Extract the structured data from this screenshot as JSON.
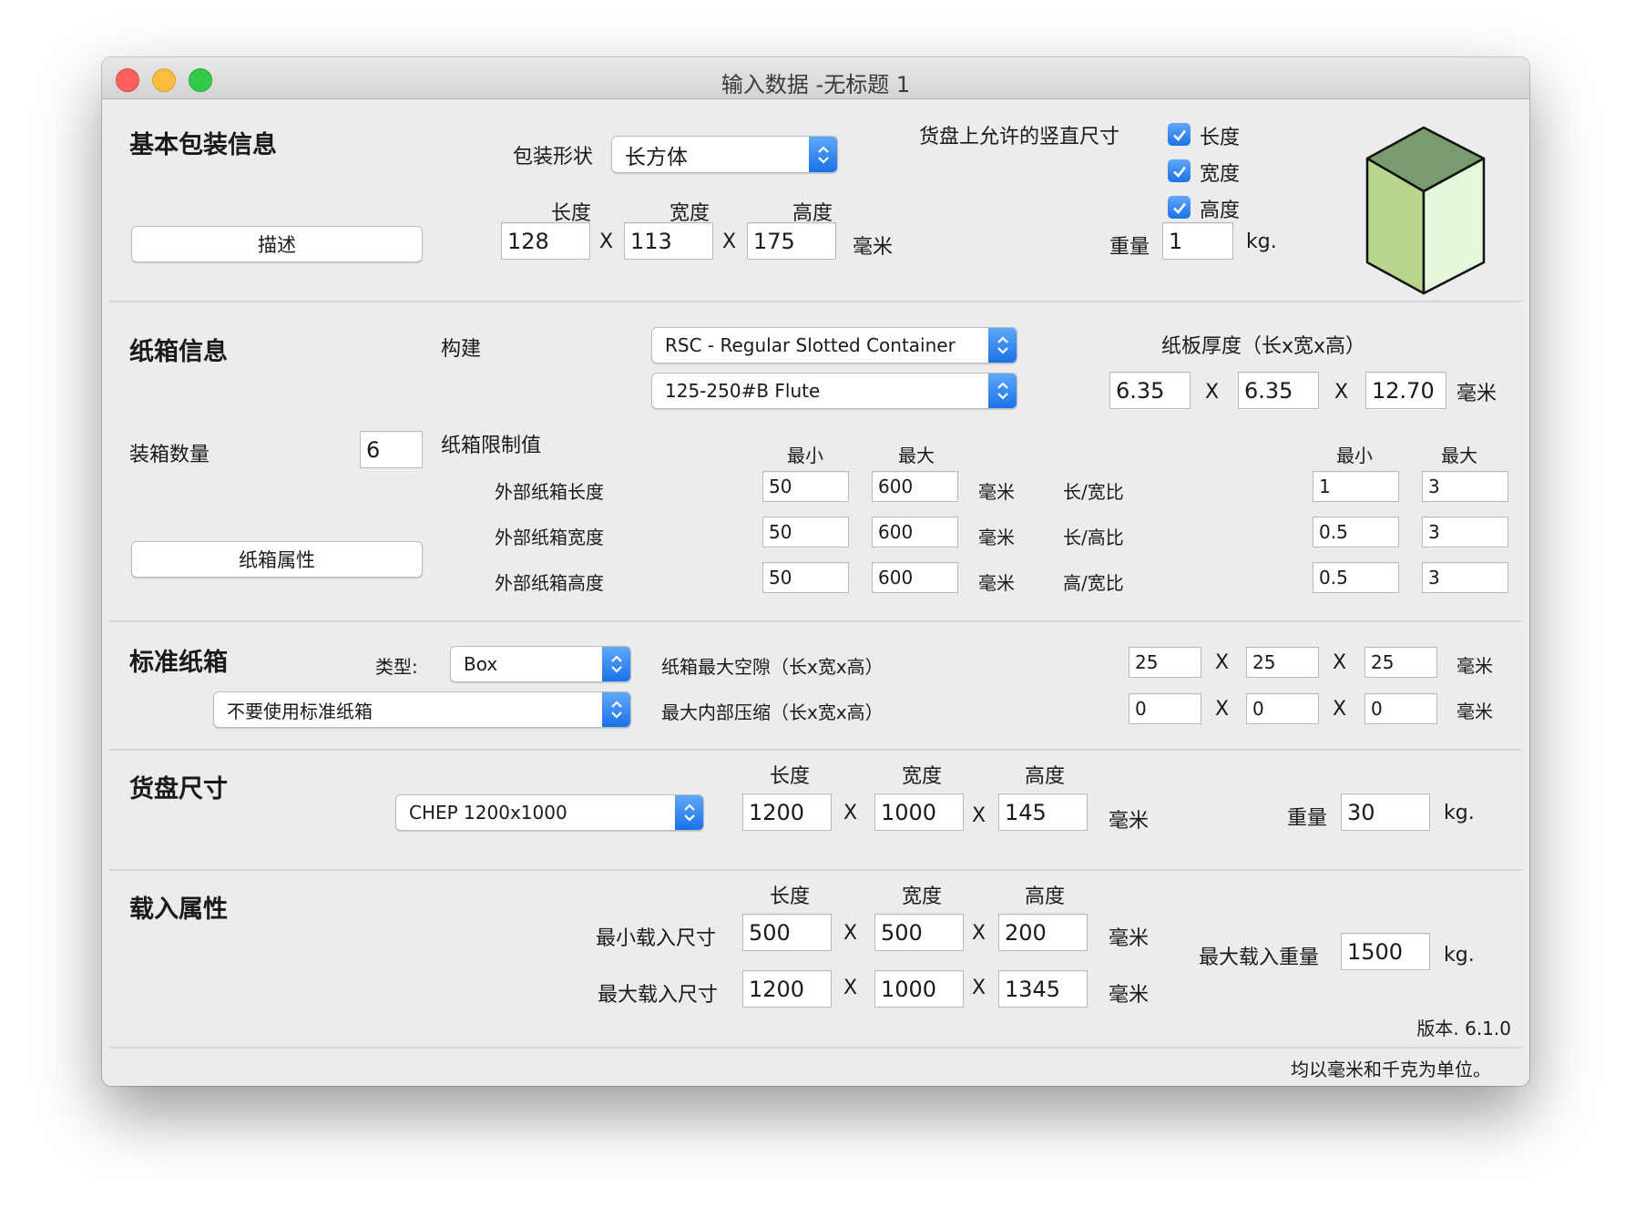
{
  "window": {
    "title": "输入数据 -无标题 1"
  },
  "basic": {
    "section": "基本包装信息",
    "shape_label": "包装形状",
    "shape_value": "长方体",
    "allowed_vertical_label": "货盘上允许的竖直尺寸",
    "checks": [
      "长度",
      "宽度",
      "高度"
    ],
    "headers": [
      "长度",
      "宽度",
      "高度"
    ],
    "describe_button": "描述",
    "length": "128",
    "width": "113",
    "height": "175",
    "x": "X",
    "unit": "毫米",
    "weight_label": "重量",
    "weight": "1",
    "weight_unit": "kg.",
    "cube_colors": {
      "top": "#7a9a70",
      "left": "#b9d48c",
      "right": "#e4f7da"
    }
  },
  "carton": {
    "section": "纸箱信息",
    "build_label": "构建",
    "style_value": "RSC - Regular Slotted Container",
    "flute_value": "125-250#B Flute",
    "thickness_label": "纸板厚度（长x宽x高）",
    "thickness": [
      "6.35",
      "6.35",
      "12.70"
    ],
    "x": "X",
    "unit": "毫米",
    "count_label": "装箱数量",
    "count": "6",
    "limits_label": "纸箱限制值",
    "min_label": "最小",
    "max_label": "最大",
    "props_button": "纸箱属性",
    "dim_rows": [
      {
        "label": "外部纸箱长度",
        "min": "50",
        "max": "600",
        "unit": "毫米"
      },
      {
        "label": "外部纸箱宽度",
        "min": "50",
        "max": "600",
        "unit": "毫米"
      },
      {
        "label": "外部纸箱高度",
        "min": "50",
        "max": "600",
        "unit": "毫米"
      }
    ],
    "ratio_rows": [
      {
        "label": "长/宽比",
        "min": "1",
        "max": "3"
      },
      {
        "label": "长/高比",
        "min": "0.5",
        "max": "3"
      },
      {
        "label": "高/宽比",
        "min": "0.5",
        "max": "3"
      }
    ]
  },
  "standard": {
    "section": "标准纸箱",
    "type_label": "类型:",
    "type_value": "Box",
    "use_value": "不要使用标准纸箱",
    "gap_label": "纸箱最大空隙（长x宽x高）",
    "gap": [
      "25",
      "25",
      "25"
    ],
    "compress_label": "最大内部压缩（长x宽x高）",
    "compress": [
      "0",
      "0",
      "0"
    ],
    "x": "X",
    "unit": "毫米"
  },
  "pallet": {
    "section": "货盘尺寸",
    "preset": "CHEP 1200x1000",
    "headers": [
      "长度",
      "宽度",
      "高度"
    ],
    "length": "1200",
    "width": "1000",
    "height": "145",
    "x": "X",
    "unit": "毫米",
    "weight_label": "重量",
    "weight": "30",
    "weight_unit": "kg."
  },
  "load": {
    "section": "载入属性",
    "headers": [
      "长度",
      "宽度",
      "高度"
    ],
    "min_label": "最小载入尺寸",
    "min": [
      "500",
      "500",
      "200"
    ],
    "max_label": "最大载入尺寸",
    "max": [
      "1200",
      "1000",
      "1345"
    ],
    "x": "X",
    "unit": "毫米",
    "max_weight_label": "最大载入重量",
    "max_weight": "1500",
    "weight_unit": "kg.",
    "version": "版本. 6.1.0",
    "note": "均以毫米和千克为单位。"
  }
}
